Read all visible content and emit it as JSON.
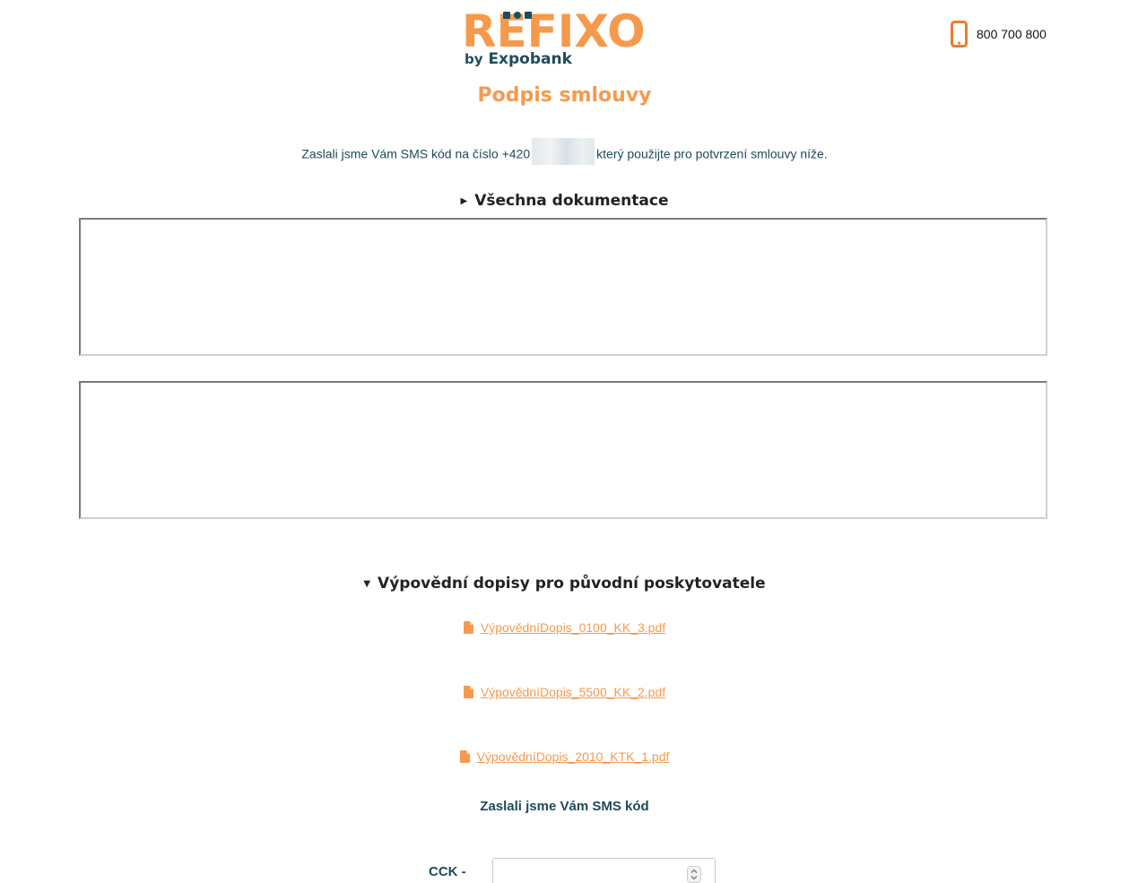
{
  "brand": {
    "name": "REFIXO",
    "sub_by": "by",
    "sub_name": "Expobank",
    "colors": {
      "orange": "#f59a4d",
      "teal": "#1d4d5d"
    }
  },
  "header": {
    "phone_icon": "smartphone-icon",
    "phone_number": "800 700 800"
  },
  "page": {
    "title": "Podpis smlouvy",
    "sms_text_before": "Zaslali jsme Vám SMS kód na číslo +420",
    "sms_text_after": "který použijte pro potvrzení smlouvy níže."
  },
  "sections": {
    "documentation": {
      "label": "Všechna dokumentace",
      "expanded": false
    },
    "letters": {
      "label": "Výpovědní dopisy pro původní poskytovatele",
      "expanded": true,
      "files": [
        {
          "name": "VýpovědníDopis_0100_KK_3.pdf",
          "icon": "file-icon"
        },
        {
          "name": "VýpovědníDopis_5500_KK_2.pdf",
          "icon": "file-icon"
        },
        {
          "name": "VýpovědníDopis_2010_KTK_1.pdf",
          "icon": "file-icon"
        }
      ]
    }
  },
  "sms_form": {
    "heading": "Zaslali jsme Vám SMS kód",
    "code_label": "CCK -",
    "code_value": ""
  }
}
